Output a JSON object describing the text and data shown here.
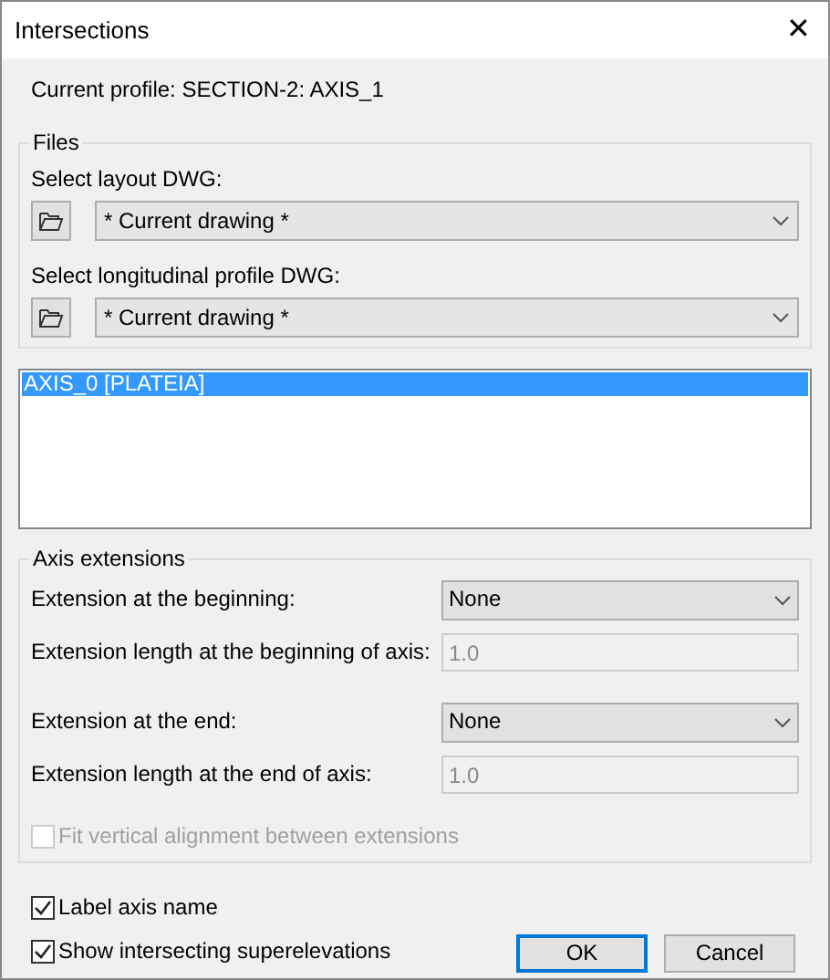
{
  "window": {
    "title": "Intersections",
    "close": "✕"
  },
  "current_profile": "Current profile: SECTION-2: AXIS_1",
  "files": {
    "legend": "Files",
    "selectors": [
      {
        "label": "Select layout DWG:",
        "value": "* Current drawing *"
      },
      {
        "label": "Select longitudinal profile DWG:",
        "value": "* Current drawing *"
      }
    ]
  },
  "axes": [
    {
      "label": "AXIS_0 [PLATEIA]",
      "selected": true
    }
  ],
  "axis_extensions": {
    "legend": "Axis extensions",
    "rows": [
      {
        "kind": "dropdown",
        "label": "Extension at the beginning:",
        "value": "None"
      },
      {
        "kind": "input",
        "label": "Extension length at the beginning of axis:",
        "value": "1.0",
        "disabled": true
      },
      {
        "kind": "dropdown",
        "label": "Extension at the end:",
        "value": "None"
      },
      {
        "kind": "input",
        "label": "Extension length at the end of axis:",
        "value": "1.0",
        "disabled": true
      }
    ],
    "fit": {
      "label": "Fit vertical alignment between extensions",
      "checked": false,
      "disabled": true
    }
  },
  "options": [
    {
      "label": "Label axis name",
      "checked": true,
      "disabled": false
    },
    {
      "label": "Show intersecting superelevations",
      "checked": true,
      "disabled": false
    }
  ],
  "buttons": [
    {
      "label": "OK",
      "default": true
    },
    {
      "label": "Cancel",
      "default": false
    }
  ]
}
